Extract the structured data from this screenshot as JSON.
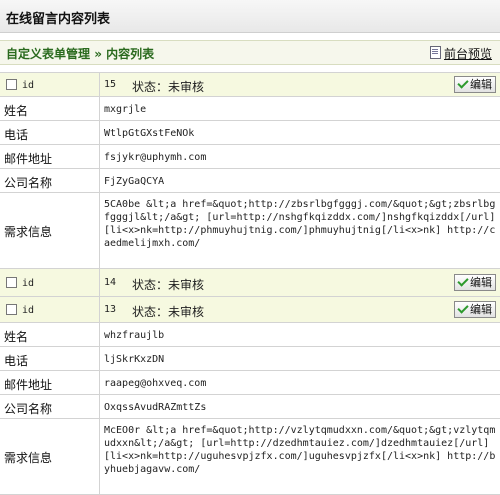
{
  "header": {
    "title": "在线留言内容列表"
  },
  "breadcrumb": {
    "root": "自定义表单管理",
    "separator": "»",
    "current": "内容列表",
    "preview": "前台预览"
  },
  "status_label": "状态：",
  "edit_label": "编辑",
  "id_label": "id",
  "field_labels": {
    "name": "姓名",
    "phone": "电话",
    "email": "邮件地址",
    "company": "公司名称",
    "needs": "需求信息"
  },
  "records": [
    {
      "id": "15",
      "status": "未审核",
      "name": "mxgrjle",
      "phone": "WtlpGtGXstFeNOk",
      "email": "fsjykr@uphymh.com",
      "company": "FjZyGaQCYA",
      "needs": "5CA0be &lt;a href=&quot;http://zbsrlbgfgggj.com/&quot;&gt;zbsrlbgfgggjl&lt;/a&gt; [url=http://nshgfkqizddx.com/]nshgfkqizddx[/url] [li<x>nk=http://phmuyhujtnig.com/]phmuyhujtnig[/li<x>nk] http://caedmelijmxh.com/"
    },
    {
      "id": "14",
      "status": "未审核"
    },
    {
      "id": "13",
      "status": "未审核",
      "name": "whzfraujlb",
      "phone": "ljSkrKxzDN",
      "email": "raapeg@ohxveq.com",
      "company": "OxqssAvudRAZmttZs",
      "needs": "McEO0r &lt;a href=&quot;http://vzlytqmudxxn.com/&quot;&gt;vzlytqmudxxn&lt;/a&gt; [url=http://dzedhmtauiez.com/]dzedhmtauiez[/url] [li<x>nk=http://uguhesvpjzfx.com/]uguhesvpjzfx[/li<x>nk] http://byhuebjagavw.com/"
    }
  ]
}
